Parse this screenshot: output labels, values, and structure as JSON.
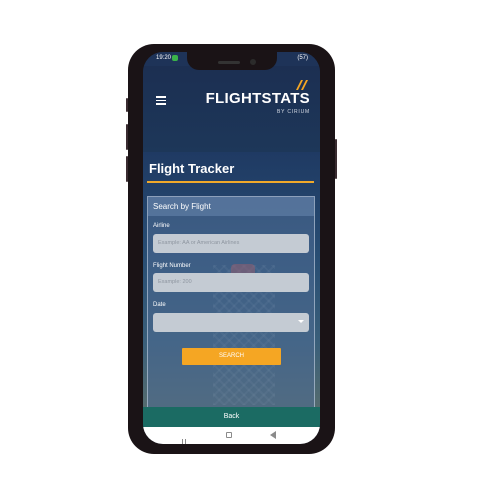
{
  "status": {
    "time": "19:20",
    "right": "(57)"
  },
  "brand": {
    "name": "FLIGHTSTATS",
    "sub": "BY CIRIUM",
    "accent": "#f5a623"
  },
  "page": {
    "title": "Flight Tracker"
  },
  "form": {
    "heading": "Search by Flight",
    "airline_label": "Airline",
    "airline_placeholder": "Example: AA or American Airlines",
    "flight_number_label": "Flight Number",
    "flight_number_placeholder": "Example: 200",
    "date_label": "Date",
    "date_value": "",
    "search_label": "SEARCH"
  },
  "back": {
    "label": "Back"
  },
  "icons": [
    "hamburger-menu-icon",
    "flightstats-logo-icon",
    "dropdown-arrow-icon",
    "recent-apps-icon",
    "home-icon",
    "back-nav-icon"
  ]
}
